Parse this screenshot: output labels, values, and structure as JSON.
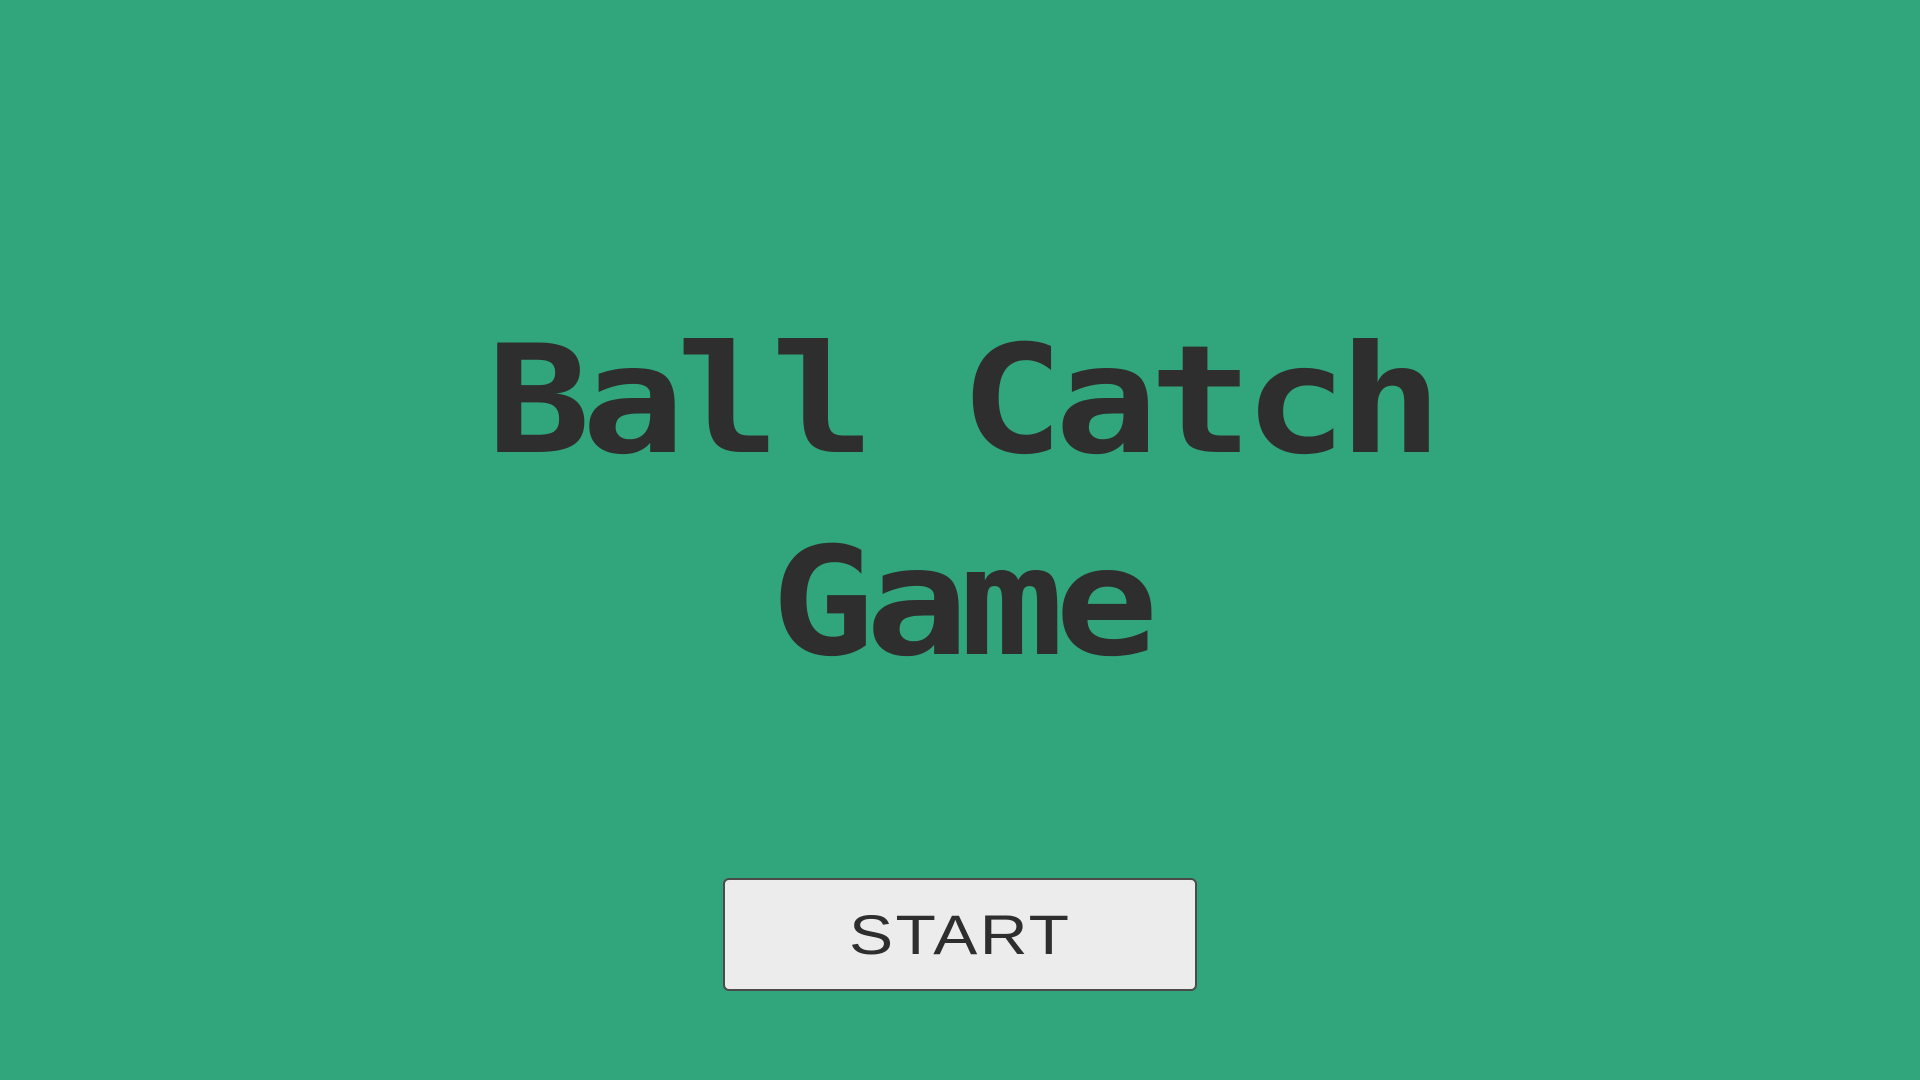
{
  "screen": {
    "background_color": "#31a57b"
  },
  "title": {
    "line1": "Ball Catch",
    "line2": "Game",
    "color": "#2e2e2e"
  },
  "start_button": {
    "label": "START",
    "background_color": "#ececec"
  }
}
